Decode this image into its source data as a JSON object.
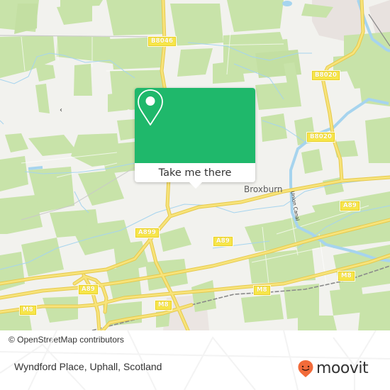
{
  "map": {
    "place_labels": [
      {
        "id": "broxburn",
        "text": "Broxburn"
      }
    ],
    "road_labels": [
      {
        "id": "b8046",
        "text": "B8046"
      },
      {
        "id": "b8020-north",
        "text": "B8020"
      },
      {
        "id": "b8020-east",
        "text": "B8020"
      },
      {
        "id": "a89-east",
        "text": "A89"
      },
      {
        "id": "a899",
        "text": "A899"
      },
      {
        "id": "a89-mid",
        "text": "A89"
      },
      {
        "id": "a89-west",
        "text": "A89"
      },
      {
        "id": "m8-west",
        "text": "M8"
      },
      {
        "id": "m8-mid",
        "text": "M8"
      },
      {
        "id": "m8-center",
        "text": "M8"
      },
      {
        "id": "m8-east",
        "text": "M8"
      }
    ],
    "waterway_labels": [
      {
        "id": "union-canal",
        "text": "Union Canal"
      }
    ],
    "attribution": "© OpenStreetMap contributors",
    "colors": {
      "background": "#f2f2ee",
      "fields": "#c8e3a9",
      "urban": "#e8e2df",
      "water": "#a6d4ee",
      "road": "#f7e37a",
      "road_casing": "#e6c94b"
    }
  },
  "popup": {
    "icon": "location-pin-icon",
    "action_label": "Take me there",
    "accent_color": "#1fb86b"
  },
  "footer": {
    "location_name": "Wyndford Place, Uphall, Scotland",
    "brand": {
      "icon": "moovit-logo-icon",
      "name": "moovit",
      "accent_color": "#f26b3a"
    }
  }
}
